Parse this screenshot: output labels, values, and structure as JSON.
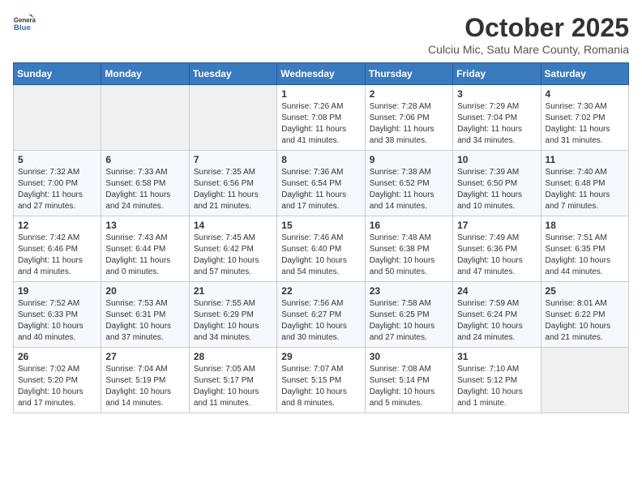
{
  "logo": {
    "general": "General",
    "blue": "Blue"
  },
  "header": {
    "month": "October 2025",
    "location": "Culciu Mic, Satu Mare County, Romania"
  },
  "weekdays": [
    "Sunday",
    "Monday",
    "Tuesday",
    "Wednesday",
    "Thursday",
    "Friday",
    "Saturday"
  ],
  "weeks": [
    [
      {
        "day": "",
        "info": ""
      },
      {
        "day": "",
        "info": ""
      },
      {
        "day": "",
        "info": ""
      },
      {
        "day": "1",
        "info": "Sunrise: 7:26 AM\nSunset: 7:08 PM\nDaylight: 11 hours\nand 41 minutes."
      },
      {
        "day": "2",
        "info": "Sunrise: 7:28 AM\nSunset: 7:06 PM\nDaylight: 11 hours\nand 38 minutes."
      },
      {
        "day": "3",
        "info": "Sunrise: 7:29 AM\nSunset: 7:04 PM\nDaylight: 11 hours\nand 34 minutes."
      },
      {
        "day": "4",
        "info": "Sunrise: 7:30 AM\nSunset: 7:02 PM\nDaylight: 11 hours\nand 31 minutes."
      }
    ],
    [
      {
        "day": "5",
        "info": "Sunrise: 7:32 AM\nSunset: 7:00 PM\nDaylight: 11 hours\nand 27 minutes."
      },
      {
        "day": "6",
        "info": "Sunrise: 7:33 AM\nSunset: 6:58 PM\nDaylight: 11 hours\nand 24 minutes."
      },
      {
        "day": "7",
        "info": "Sunrise: 7:35 AM\nSunset: 6:56 PM\nDaylight: 11 hours\nand 21 minutes."
      },
      {
        "day": "8",
        "info": "Sunrise: 7:36 AM\nSunset: 6:54 PM\nDaylight: 11 hours\nand 17 minutes."
      },
      {
        "day": "9",
        "info": "Sunrise: 7:38 AM\nSunset: 6:52 PM\nDaylight: 11 hours\nand 14 minutes."
      },
      {
        "day": "10",
        "info": "Sunrise: 7:39 AM\nSunset: 6:50 PM\nDaylight: 11 hours\nand 10 minutes."
      },
      {
        "day": "11",
        "info": "Sunrise: 7:40 AM\nSunset: 6:48 PM\nDaylight: 11 hours\nand 7 minutes."
      }
    ],
    [
      {
        "day": "12",
        "info": "Sunrise: 7:42 AM\nSunset: 6:46 PM\nDaylight: 11 hours\nand 4 minutes."
      },
      {
        "day": "13",
        "info": "Sunrise: 7:43 AM\nSunset: 6:44 PM\nDaylight: 11 hours\nand 0 minutes."
      },
      {
        "day": "14",
        "info": "Sunrise: 7:45 AM\nSunset: 6:42 PM\nDaylight: 10 hours\nand 57 minutes."
      },
      {
        "day": "15",
        "info": "Sunrise: 7:46 AM\nSunset: 6:40 PM\nDaylight: 10 hours\nand 54 minutes."
      },
      {
        "day": "16",
        "info": "Sunrise: 7:48 AM\nSunset: 6:38 PM\nDaylight: 10 hours\nand 50 minutes."
      },
      {
        "day": "17",
        "info": "Sunrise: 7:49 AM\nSunset: 6:36 PM\nDaylight: 10 hours\nand 47 minutes."
      },
      {
        "day": "18",
        "info": "Sunrise: 7:51 AM\nSunset: 6:35 PM\nDaylight: 10 hours\nand 44 minutes."
      }
    ],
    [
      {
        "day": "19",
        "info": "Sunrise: 7:52 AM\nSunset: 6:33 PM\nDaylight: 10 hours\nand 40 minutes."
      },
      {
        "day": "20",
        "info": "Sunrise: 7:53 AM\nSunset: 6:31 PM\nDaylight: 10 hours\nand 37 minutes."
      },
      {
        "day": "21",
        "info": "Sunrise: 7:55 AM\nSunset: 6:29 PM\nDaylight: 10 hours\nand 34 minutes."
      },
      {
        "day": "22",
        "info": "Sunrise: 7:56 AM\nSunset: 6:27 PM\nDaylight: 10 hours\nand 30 minutes."
      },
      {
        "day": "23",
        "info": "Sunrise: 7:58 AM\nSunset: 6:25 PM\nDaylight: 10 hours\nand 27 minutes."
      },
      {
        "day": "24",
        "info": "Sunrise: 7:59 AM\nSunset: 6:24 PM\nDaylight: 10 hours\nand 24 minutes."
      },
      {
        "day": "25",
        "info": "Sunrise: 8:01 AM\nSunset: 6:22 PM\nDaylight: 10 hours\nand 21 minutes."
      }
    ],
    [
      {
        "day": "26",
        "info": "Sunrise: 7:02 AM\nSunset: 5:20 PM\nDaylight: 10 hours\nand 17 minutes."
      },
      {
        "day": "27",
        "info": "Sunrise: 7:04 AM\nSunset: 5:19 PM\nDaylight: 10 hours\nand 14 minutes."
      },
      {
        "day": "28",
        "info": "Sunrise: 7:05 AM\nSunset: 5:17 PM\nDaylight: 10 hours\nand 11 minutes."
      },
      {
        "day": "29",
        "info": "Sunrise: 7:07 AM\nSunset: 5:15 PM\nDaylight: 10 hours\nand 8 minutes."
      },
      {
        "day": "30",
        "info": "Sunrise: 7:08 AM\nSunset: 5:14 PM\nDaylight: 10 hours\nand 5 minutes."
      },
      {
        "day": "31",
        "info": "Sunrise: 7:10 AM\nSunset: 5:12 PM\nDaylight: 10 hours\nand 1 minute."
      },
      {
        "day": "",
        "info": ""
      }
    ]
  ]
}
